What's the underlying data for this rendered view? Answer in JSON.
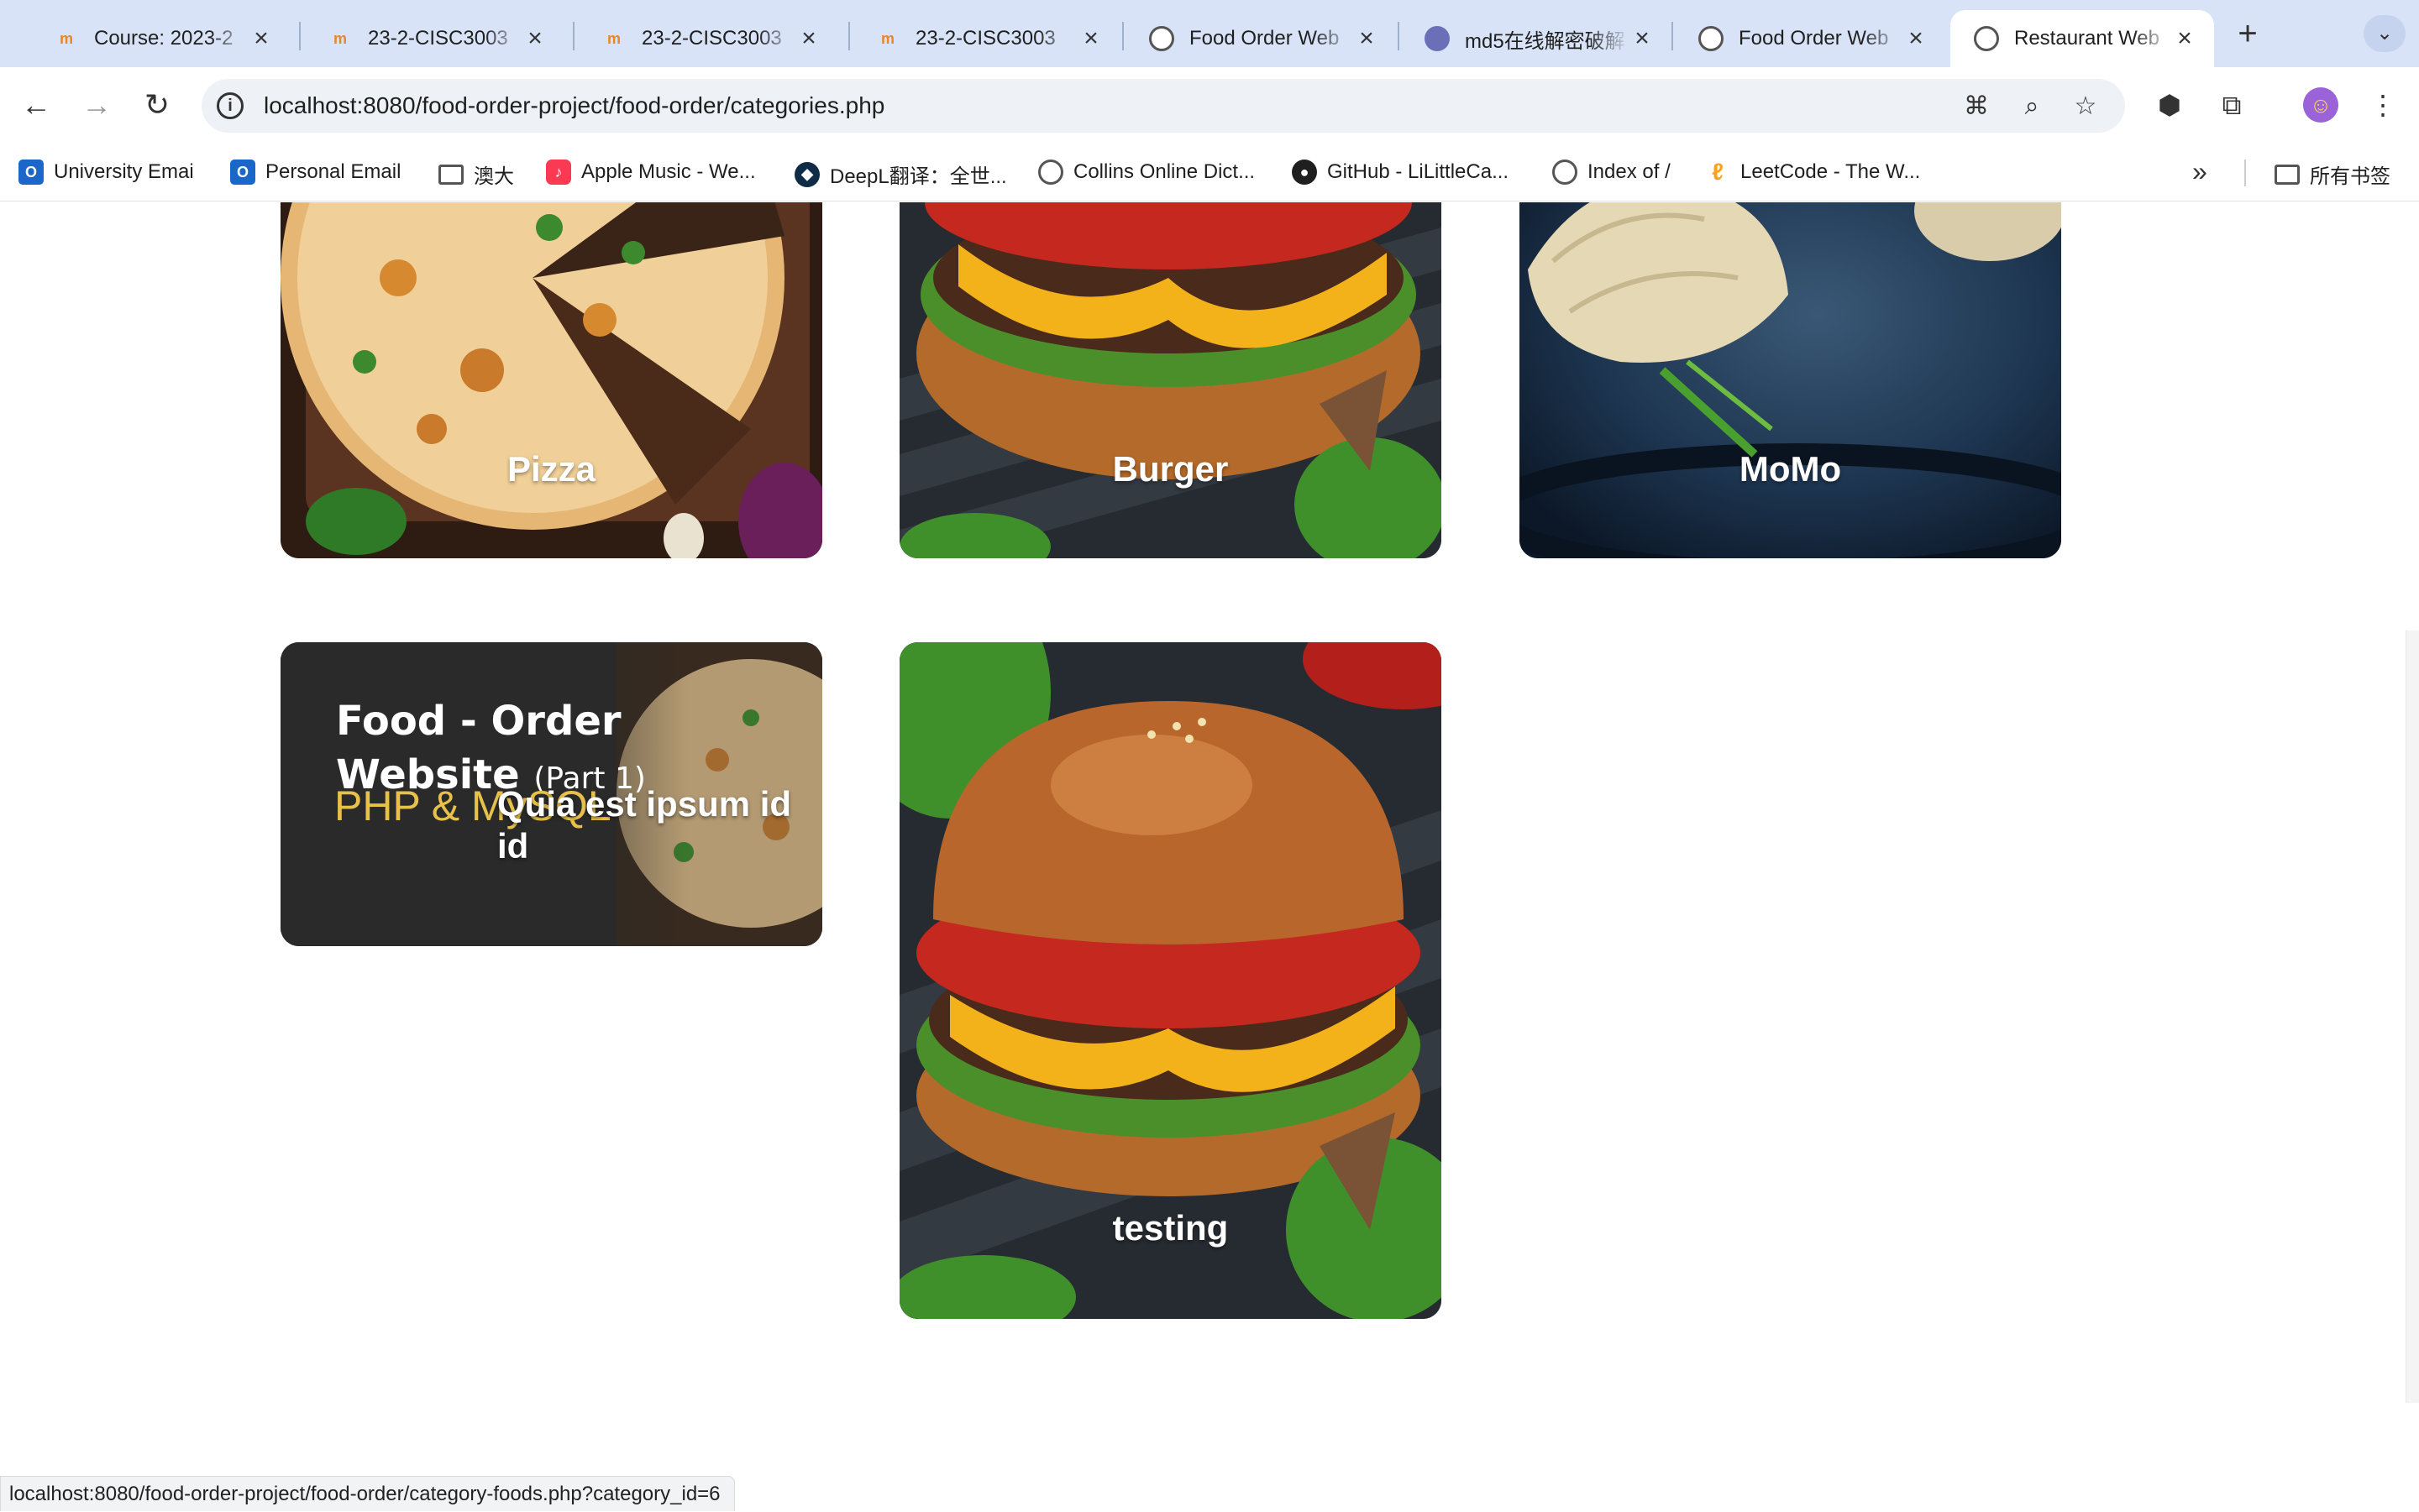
{
  "browser": {
    "tabs": [
      {
        "title": "Course: 2023-2",
        "icon": "moodle-icon",
        "active": false
      },
      {
        "title": "23-2-CISC3003",
        "icon": "moodle-icon",
        "active": false
      },
      {
        "title": "23-2-CISC3003",
        "icon": "moodle-icon",
        "active": false
      },
      {
        "title": "23-2-CISC3003",
        "icon": "moodle-icon",
        "active": false
      },
      {
        "title": "Food Order Web",
        "icon": "globe-icon",
        "active": false
      },
      {
        "title": "md5在线解密破解",
        "icon": "md5-site-icon",
        "active": false
      },
      {
        "title": "Food Order Web",
        "icon": "globe-icon",
        "active": false
      },
      {
        "title": "Restaurant Web",
        "icon": "globe-icon",
        "active": true
      }
    ],
    "address": "localhost:8080/food-order-project/food-order/categories.php",
    "bookmarks": [
      {
        "label": "University Emai",
        "icon": "outlook-icon"
      },
      {
        "label": "Personal Email",
        "icon": "outlook-icon"
      },
      {
        "label": "澳大",
        "icon": "folder-icon"
      },
      {
        "label": "Apple Music - We...",
        "icon": "apple-music-icon"
      },
      {
        "label": "DeepL翻译：全世...",
        "icon": "deepl-icon"
      },
      {
        "label": "Collins Online Dict...",
        "icon": "globe-icon"
      },
      {
        "label": "GitHub - LiLittleCa...",
        "icon": "github-icon"
      },
      {
        "label": "Index of /",
        "icon": "globe-icon"
      },
      {
        "label": "LeetCode - The W...",
        "icon": "leetcode-icon"
      }
    ],
    "bookmarks_more": "»",
    "all_bookmarks": "所有书签",
    "status_url": "localhost:8080/food-order-project/food-order/category-foods.php?category_id=6"
  },
  "categories": [
    {
      "title": "Pizza",
      "image": "pizza-photo"
    },
    {
      "title": "Burger",
      "image": "burger-photo"
    },
    {
      "title": "MoMo",
      "image": "momo-photo"
    },
    {
      "title": "Quia est ipsum id id",
      "image": "tutorial-thumbnail"
    },
    {
      "title": "testing",
      "image": "burger-photo"
    }
  ],
  "thumbnail_text": {
    "line1": "Food - Order",
    "line2": "Website",
    "part": "(Part 1)",
    "tech": "PHP & MySQL"
  }
}
